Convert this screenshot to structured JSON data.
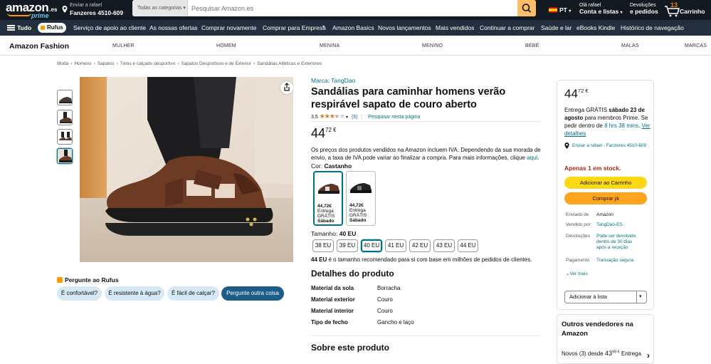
{
  "header": {
    "logo_text": "amazon",
    "logo_suffix": ".es",
    "logo_prime": "prime",
    "deliver_line1": "Enviar a rafael",
    "deliver_line2": "Fanzeres 4510-609",
    "search_category": "Todas as categorias",
    "search_placeholder": "Pesquisar Amazon.es",
    "language": "PT",
    "account_line1": "Olá rafael",
    "account_line2": "Conta e listas",
    "returns_line1": "Devoluções",
    "returns_line2": "e pedidos",
    "cart_count": "13",
    "cart_label": "Carrinho"
  },
  "nav": {
    "all_label": "Tudo",
    "rufus_label": "Rufus",
    "items": [
      "Serviço de apoio ao cliente",
      "As nossas ofertas",
      "Comprar novamente",
      "Comprar para Empresa",
      "Amazon Basics",
      "Novos lançamentos",
      "Mais vendidos",
      "Continuar a comprar",
      "Saúde e lar",
      "eBooks Kindle",
      "Histórico de navegação"
    ]
  },
  "fashion": {
    "brand": "Amazon Fashion",
    "categories": [
      "MULHER",
      "HOMEM",
      "MENINA",
      "MENINO",
      "BEBÉ",
      "MALAS",
      "MARCAS"
    ]
  },
  "breadcrumb": [
    "Moda",
    "Homens",
    "Sapatos",
    "Ténis e calçado desportivo",
    "Sapatos Desportivos e de Exterior",
    "Sandálias Atléticas e Exteriores"
  ],
  "product": {
    "brand": "Marca: TangDao",
    "title": "Sandálias para caminhar homens verão respirável sapato de couro aberto",
    "rating": "3.5",
    "rating_stars": 3.5,
    "reviews": "(6)",
    "search_page": "Pesquisar nesta página",
    "price_whole": "44",
    "price_fraction": "72",
    "currency": "€",
    "vat_text": "Os preços dos produtos vendidos na Amazon incluem IVA. Dependendo da sua morada de envio, a taxa de IVA pode variar ao finalizar a compra. Para mais informações, clique",
    "vat_link": "aqui",
    "color_label": "Cor:",
    "color_value": "Castanho",
    "swatches": [
      {
        "price": "44,72€",
        "line1": "Entrega",
        "line2": "GRÁTIS",
        "line3": "Sábado"
      },
      {
        "price": "44,72€",
        "line1": "Entrega",
        "line2": "GRÁTIS",
        "line3": "Sábado"
      }
    ],
    "size_label": "Tamanho:",
    "size_value": "40 EU",
    "sizes": [
      "38 EU",
      "39 EU",
      "40 EU",
      "41 EU",
      "42 EU",
      "43 EU",
      "44 EU"
    ],
    "size_selected": 2,
    "recommend_bold": "44 EU",
    "recommend_text": "é o tamanho recomendado para si com base em milhões de pedidos de clientes.",
    "details_title": "Detalhes do produto",
    "details": [
      {
        "k": "Material da sola",
        "v": "Borracha"
      },
      {
        "k": "Material exterior",
        "v": "Couro"
      },
      {
        "k": "Material interior",
        "v": "Couro"
      },
      {
        "k": "Tipo de fecho",
        "v": "Gancho e laço"
      }
    ],
    "about_title": "Sobre este produto"
  },
  "rufus": {
    "title": "Pergunte ao Rufus",
    "chips": [
      "É confortável?",
      "É resistente à água?",
      "É fácil de calçar?",
      "Pergunte outra coisa"
    ]
  },
  "buybox": {
    "price_whole": "44",
    "price_fraction": "72",
    "currency": "€",
    "ship_pre": "Entrega GRÁTIS",
    "ship_date": "sábado 23 de agosto",
    "ship_mid": "para membros Prime. Se pedir dentro de",
    "ship_time": "8 hrs 38 mins",
    "ship_details": "Ver detalhes",
    "address": "Enviar a rafael - Fanzeres 4510-609",
    "stock": "Apenas 1 em stock.",
    "add_to_cart": "Adicionar ao Carrinho",
    "buy_now": "Comprar já",
    "info": [
      {
        "k": "Enviado de",
        "v": "Amazon"
      },
      {
        "k": "Vendido por",
        "v": "TangDao-ES"
      },
      {
        "k": "Devoluções",
        "v": "Pode ser devolvido dentro de 30 dias após a receção"
      },
      {
        "k": "Pagamento",
        "v": "Transação segura"
      }
    ],
    "see_more": "Ver mais",
    "add_list": "Adicionar à lista",
    "colors": {
      "cart_btn": "#ffd814",
      "buy_btn": "#ffa41c",
      "link": "#007185",
      "stock": "#b12704"
    }
  },
  "other_sellers": {
    "title": "Outros vendedores na Amazon",
    "new_label": "Novos (3) desde",
    "price_whole": "43",
    "price_fraction": "99",
    "currency": "€",
    "delivery": "Entrega"
  },
  "icons": [
    "location-pin-icon",
    "search-icon",
    "cart-icon",
    "menu-icon",
    "share-icon",
    "chevron-down-icon",
    "chevron-right-icon",
    "star-icon",
    "rufus-icon"
  ]
}
